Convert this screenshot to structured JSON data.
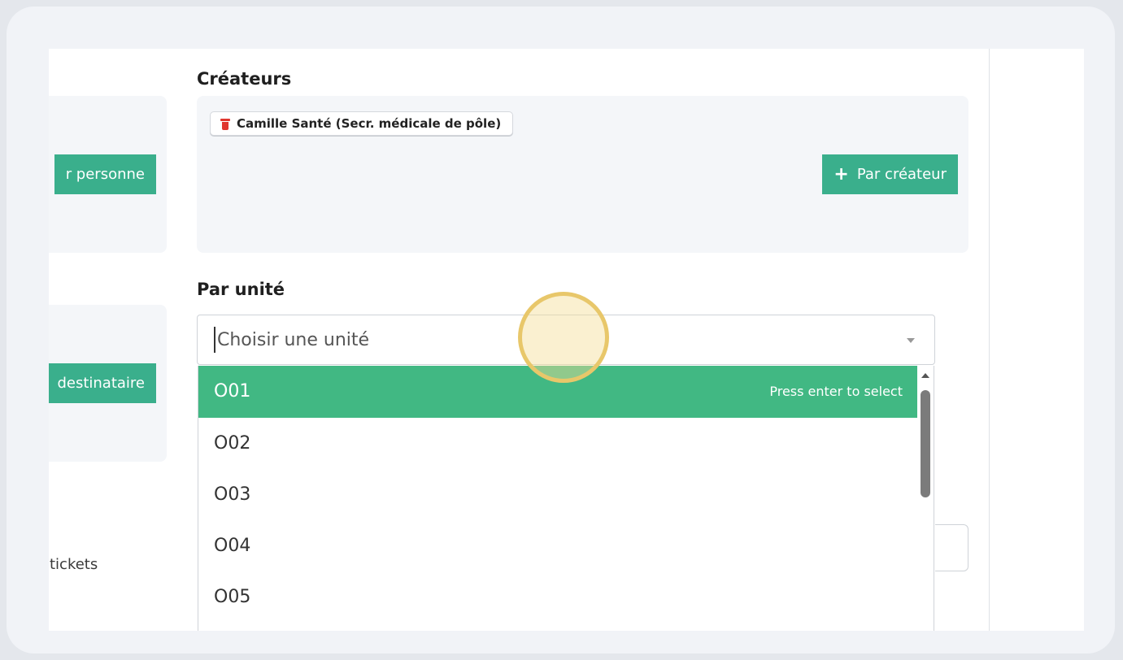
{
  "left_column": {
    "btn_personne": "r personne",
    "btn_destinataire": "destinataire",
    "tickets_text": "tickets"
  },
  "createurs": {
    "title": "Créateurs",
    "chip": "Camille Santé (Secr. médicale de pôle)",
    "add_button": "Par créateur"
  },
  "unite": {
    "title": "Par unité",
    "placeholder": "Choisir une unité",
    "hint": "Press enter to select",
    "options": [
      "O01",
      "O02",
      "O03",
      "O04",
      "O05"
    ]
  },
  "colors": {
    "accent": "#41b883",
    "button": "#3aaf8c",
    "danger": "#e0362f"
  },
  "icons": {
    "trash": "trash-icon",
    "plus": "plus-icon",
    "caret": "chevron-down-icon"
  }
}
